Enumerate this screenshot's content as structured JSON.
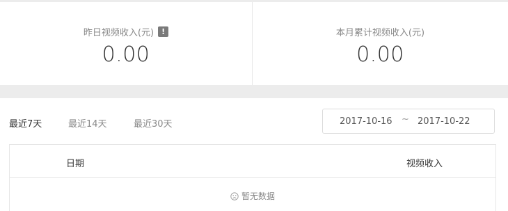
{
  "stats": {
    "yesterday_label": "昨日视频收入(元)",
    "yesterday_value": "0.00",
    "month_label": "本月累计视频收入(元)",
    "month_value": "0.00",
    "info_icon_glyph": "!"
  },
  "tabs": [
    {
      "label": "最近7天",
      "active": true
    },
    {
      "label": "最近14天",
      "active": false
    },
    {
      "label": "最近30天",
      "active": false
    }
  ],
  "daterange": {
    "start": "2017-10-16",
    "separator": "~",
    "end": "2017-10-22"
  },
  "table": {
    "columns": [
      "日期",
      "视频收入"
    ],
    "empty_text": "暂无数据"
  },
  "icons": {
    "info": "info-icon",
    "empty": "sad-face-icon"
  }
}
